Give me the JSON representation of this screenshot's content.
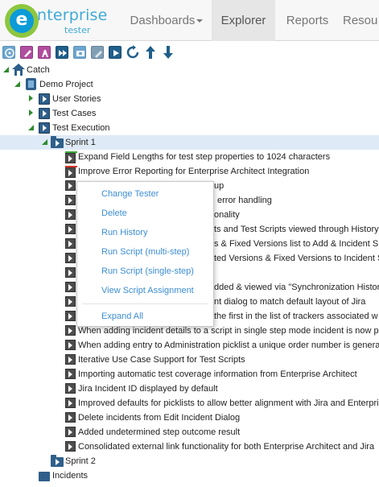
{
  "app": {
    "logo_primary": "nterprise",
    "logo_secondary": "tester",
    "logo_letter": "e"
  },
  "nav": {
    "items": [
      {
        "label": "Dashboards",
        "has_caret": true,
        "active": false
      },
      {
        "label": "Explorer",
        "has_caret": false,
        "active": true
      },
      {
        "label": "Reports",
        "has_caret": false,
        "active": false
      },
      {
        "label": "Resou",
        "has_caret": false,
        "active": false
      }
    ]
  },
  "toolbar": {
    "icons": [
      "target-icon",
      "edit-icon",
      "rename-icon",
      "fast-forward-icon",
      "camera-icon",
      "tag-icon",
      "run-icon",
      "refresh-icon",
      "arrow-up-icon",
      "arrow-down-icon"
    ]
  },
  "tree": {
    "root": "Catch",
    "project": "Demo Project",
    "folders": [
      "User Stories",
      "Test Cases",
      "Test Execution"
    ],
    "sprint1": "Sprint 1",
    "scripts": [
      "Expand Field Lengths for test step properties to 1024 characters",
      "Improve Error Reporting for Enterprise Architect Integration",
      "up",
      "error handling",
      "onality",
      "ts and Test Scripts viewed through History",
      "s & Fixed Versions list to Add & Incident S",
      "ted Versions & Fixed Versions to Incident S",
      "",
      "dded & viewed via \"Synchronization Histor",
      "nt dialog to match default layout of Jira",
      "the first in the list of trackers associated w",
      "When adding incident details to a script in single step mode incident is now pre",
      "When adding entry to Administration picklist a unique order number is generat",
      "Iterative Use Case Support for Test Scripts",
      "Importing automatic test coverage information from Enterprise Architect",
      "Jira Incident ID displayed by default",
      "Improved defaults for picklists to allow better alignment with Jira and Enterpris",
      "Delete incidents from Edit Incident Dialog",
      "Added undetermined step outcome result",
      "Consolidated external link functionality for both Enterprise Architect and Jira"
    ],
    "sprint2": "Sprint 2",
    "incidents": "Incidents"
  },
  "context_menu": {
    "items": [
      "Change Tester",
      "Delete",
      "Run History",
      "Run Script (multi-step)",
      "Run Script (single-step)",
      "View Script Assignment",
      "Expand All"
    ]
  },
  "colors": {
    "accent_link": "#3c8ed4",
    "tree_toggle": "#2e8b2e",
    "selection": "#dfeaf7",
    "status_pass": "#3aaa35",
    "status_fail": "#d9352b"
  }
}
